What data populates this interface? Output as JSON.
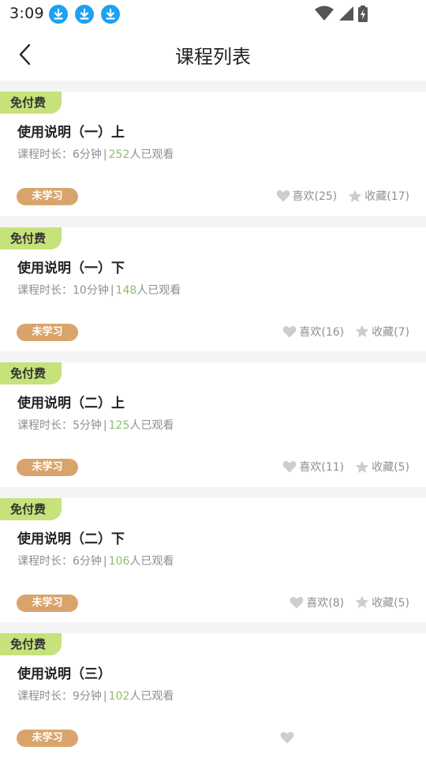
{
  "status_bar": {
    "time": "3:09"
  },
  "header": {
    "title": "课程列表"
  },
  "colors": {
    "free_badge": "#c6e27a",
    "status_pill": "#d9a46c",
    "view_count": "#8fbf6c",
    "download_icon": "#1da1f2"
  },
  "courses": [
    {
      "badge": "免付费",
      "title": "使用说明（一）上",
      "duration_label": "课程时长：",
      "duration": "6分钟",
      "separator": "|",
      "views": "252",
      "views_suffix": "人已观看",
      "status": "未学习",
      "likes": "喜欢(25)",
      "favorites": "收藏(17)"
    },
    {
      "badge": "免付费",
      "title": "使用说明（一）下",
      "duration_label": "课程时长：",
      "duration": "10分钟",
      "separator": "|",
      "views": "148",
      "views_suffix": "人已观看",
      "status": "未学习",
      "likes": "喜欢(16)",
      "favorites": "收藏(7)"
    },
    {
      "badge": "免付费",
      "title": "使用说明（二）上",
      "duration_label": "课程时长：",
      "duration": "5分钟",
      "separator": "|",
      "views": "125",
      "views_suffix": "人已观看",
      "status": "未学习",
      "likes": "喜欢(11)",
      "favorites": "收藏(5)"
    },
    {
      "badge": "免付费",
      "title": "使用说明（二）下",
      "duration_label": "课程时长：",
      "duration": "6分钟",
      "separator": "|",
      "views": "106",
      "views_suffix": "人已观看",
      "status": "未学习",
      "likes": "喜欢(8)",
      "favorites": "收藏(5)"
    },
    {
      "badge": "免付费",
      "title": "使用说明（三）",
      "duration_label": "课程时长：",
      "duration": "9分钟",
      "separator": "|",
      "views": "102",
      "views_suffix": "人已观看",
      "status": "未学习",
      "likes": "",
      "favorites": ""
    }
  ]
}
